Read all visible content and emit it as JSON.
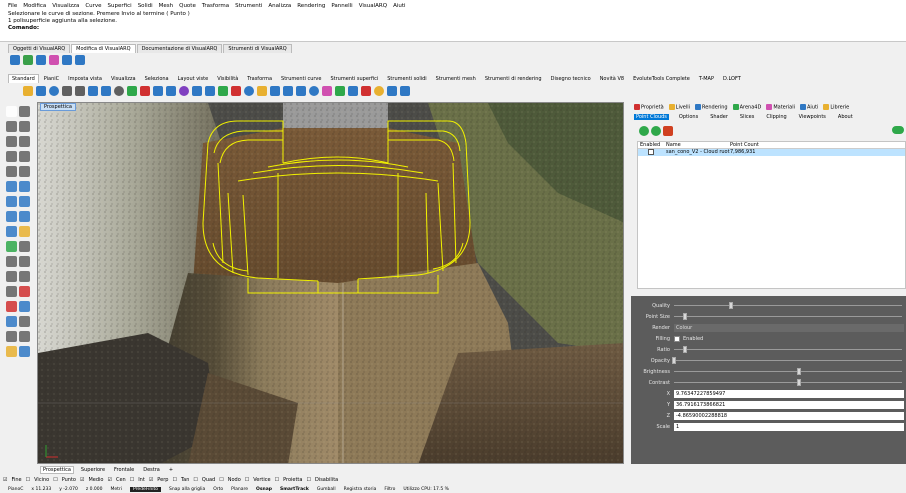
{
  "menubar": [
    "File",
    "Modifica",
    "Visualizza",
    "Curve",
    "Superfici",
    "Solidi",
    "Mesh",
    "Quote",
    "Trasforma",
    "Strumenti",
    "Analizza",
    "Rendering",
    "Pannelli",
    "VisualARQ",
    "Aiuti"
  ],
  "command": {
    "line1": "Selezionare le curve di sezione. Premere Invio al termine ( Punto )",
    "line2": "1 polisuperficie aggiunta alla selezione.",
    "prompt": "Comando:"
  },
  "tabs_row1": [
    "Oggetti di VisualARQ",
    "Modifica di VisualARQ",
    "Documentazione di VisualARQ",
    "Strumenti di VisualARQ"
  ],
  "tabs_row2": [
    "Standard",
    "PianiC",
    "Imposta vista",
    "Visualizza",
    "Seleziona",
    "Layout viste",
    "Visibilità",
    "Trasforma",
    "Strumenti curve",
    "Strumenti superfici",
    "Strumenti solidi",
    "Strumenti mesh",
    "Strumenti di rendering",
    "Disegno tecnico",
    "Novità V8",
    "EvoluteTools Complete",
    "T-MAP",
    "D.LOFT"
  ],
  "viewport": {
    "label": "Prospettica"
  },
  "viewtabs": [
    "Prospettica",
    "Superiore",
    "Frontale",
    "Destra"
  ],
  "snaps": [
    {
      "label": "Fine",
      "on": true
    },
    {
      "label": "Vicino",
      "on": false
    },
    {
      "label": "Punto",
      "on": false
    },
    {
      "label": "Medio",
      "on": true
    },
    {
      "label": "Cen",
      "on": true
    },
    {
      "label": "Int",
      "on": false
    },
    {
      "label": "Perp",
      "on": true
    },
    {
      "label": "Tan",
      "on": false
    },
    {
      "label": "Quad",
      "on": false
    },
    {
      "label": "Nodo",
      "on": false
    },
    {
      "label": "Vertice",
      "on": false
    },
    {
      "label": "Proietta",
      "on": false
    },
    {
      "label": "Disabilita",
      "on": false
    }
  ],
  "status": {
    "cplane": "PianoC",
    "x": "x 11.233",
    "y": "y -2.070",
    "z": "z 0.000",
    "units": "Metri",
    "layer": "PredeFinito",
    "items": [
      "Snap alla griglia",
      "Orto",
      "Planare",
      "Osnap",
      "SmartTrack",
      "Gumball",
      "Registra storia",
      "Filtro",
      "Utilizzo CPU: 17.5 %"
    ]
  },
  "panel": {
    "tabs": [
      "Proprietà",
      "Livelli",
      "Rendering",
      "Arena4D",
      "Materiali",
      "Aiuti",
      "Librerie"
    ],
    "subtabs": [
      "Point Clouds",
      "Options",
      "Shader",
      "Slices",
      "Clipping",
      "Viewpoints",
      "About"
    ],
    "table": {
      "headers": [
        "Enabled",
        "Name",
        "Point Count"
      ],
      "rows": [
        {
          "name": "san_cono_V2 - Cloud ruotato",
          "count": "7,986,931"
        }
      ]
    },
    "settings": {
      "quality": "Quality",
      "point_size": "Point Size",
      "render": "Render",
      "render_value": "Colour",
      "filling": "Filling",
      "filling_value": "Enabled",
      "ratio": "Ratio",
      "opacity": "Opacity",
      "brightness": "Brightness",
      "contrast": "Contrast",
      "x_label": "X",
      "x_value": "9.76347227859497",
      "y_label": "Y",
      "y_value": "36.7916173866821",
      "z_label": "Z",
      "z_value": "-4.86590002288818",
      "scale_label": "Scale",
      "scale_value": "1"
    },
    "slider_levels": {
      "quality": 0.25,
      "point_size": 0.05,
      "ratio": 0.05,
      "opacity": 0.0,
      "brightness": 0.55,
      "contrast": 0.55
    }
  },
  "colors": {
    "accent": "#0078d7",
    "wireframe": "#f2f200",
    "selection": "#bde3ff"
  }
}
